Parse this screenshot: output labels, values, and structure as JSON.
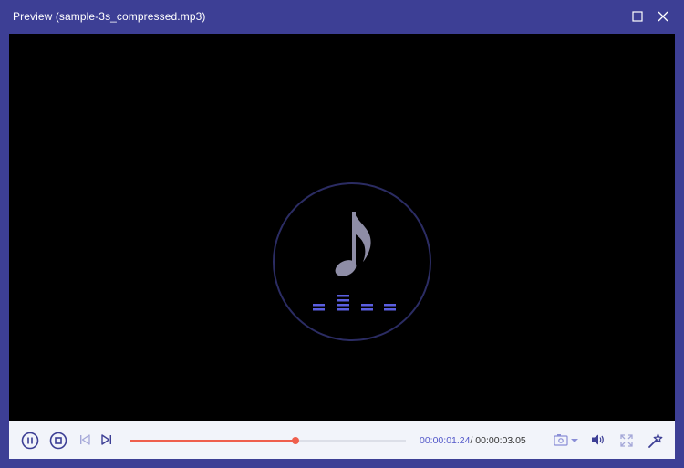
{
  "window": {
    "title": "Preview (sample-3s_compressed.mp3)",
    "maximize_icon": "maximize-icon",
    "close_icon": "close-icon"
  },
  "player": {
    "artwork_icon": "music-note-icon",
    "equalizer_icon": "equalizer-icon",
    "current_time": "00:00:01.24",
    "total_time": "/ 00:00:03.05",
    "progress_fraction": 0.6
  },
  "controls": {
    "pause_icon": "pause-icon",
    "stop_icon": "stop-icon",
    "previous_icon": "previous-icon",
    "next_icon": "next-icon",
    "snapshot_icon": "camera-icon",
    "snapshot_dropdown_icon": "chevron-down-icon",
    "volume_icon": "volume-icon",
    "fullscreen_icon": "fullscreen-icon",
    "effects_icon": "magic-wand-icon"
  },
  "colors": {
    "titlebar": "#3d3f95",
    "accent": "#5257c9",
    "progress": "#ef5f4d",
    "controls_bg": "#f2f4fa"
  }
}
